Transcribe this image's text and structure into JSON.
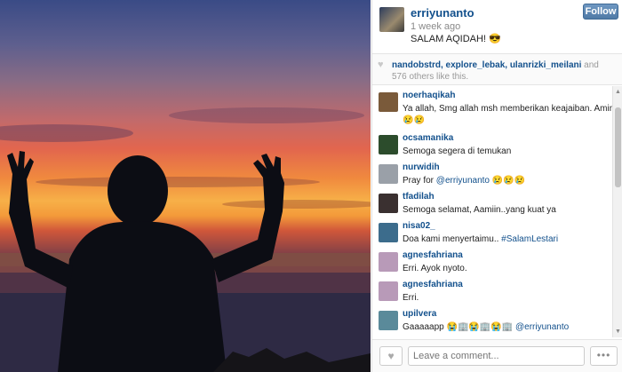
{
  "post": {
    "username": "erriyunanto",
    "time": "1 week ago",
    "caption": "SALAM AQIDAH! 😎",
    "follow_label": "Follow"
  },
  "likes": {
    "icon": "heart-icon",
    "names": "nandobstrd, explore_lebak, ulanrizki_meilani",
    "rest": " and 576 others like this."
  },
  "comments": [
    {
      "user": "noerhaqikah",
      "text": "Ya allah, Smg allah msh memberikan keajaiban. Amin..",
      "text2": "😢😢",
      "avatar_color": "#7a5a3a"
    },
    {
      "user": "ocsamanika",
      "text": "Semoga segera di temukan",
      "avatar_color": "#2c4c2c"
    },
    {
      "user": "nurwidih",
      "text_prefix": "Pray for ",
      "mention": "@erriyunanto",
      "text_suffix": " 😢😢😢",
      "avatar_color": "#9aa0a8"
    },
    {
      "user": "tfadilah",
      "text": "Semoga selamat, Aamiin..yang kuat ya",
      "avatar_color": "#3a3030"
    },
    {
      "user": "nisa02_",
      "text_prefix": "Doa kami menyertaimu.. ",
      "mention": "#SalamLestari",
      "text_suffix": "",
      "avatar_color": "#3c6c8c"
    },
    {
      "user": "agnesfahriana",
      "text": "Erri. Ayok nyoto.",
      "avatar_color": "#b89ab8"
    },
    {
      "user": "agnesfahriana",
      "text": "Erri.",
      "avatar_color": "#b89ab8"
    },
    {
      "user": "upilvera",
      "text_prefix": "Gaaaaapp 😭🏢😭🏢😭🏢 ",
      "mention": "@erriyunanto",
      "text_suffix": "",
      "avatar_color": "#5a8a9a"
    }
  ],
  "footer": {
    "like_icon": "heart-icon",
    "comment_placeholder": "Leave a comment...",
    "more_label": "•••"
  }
}
